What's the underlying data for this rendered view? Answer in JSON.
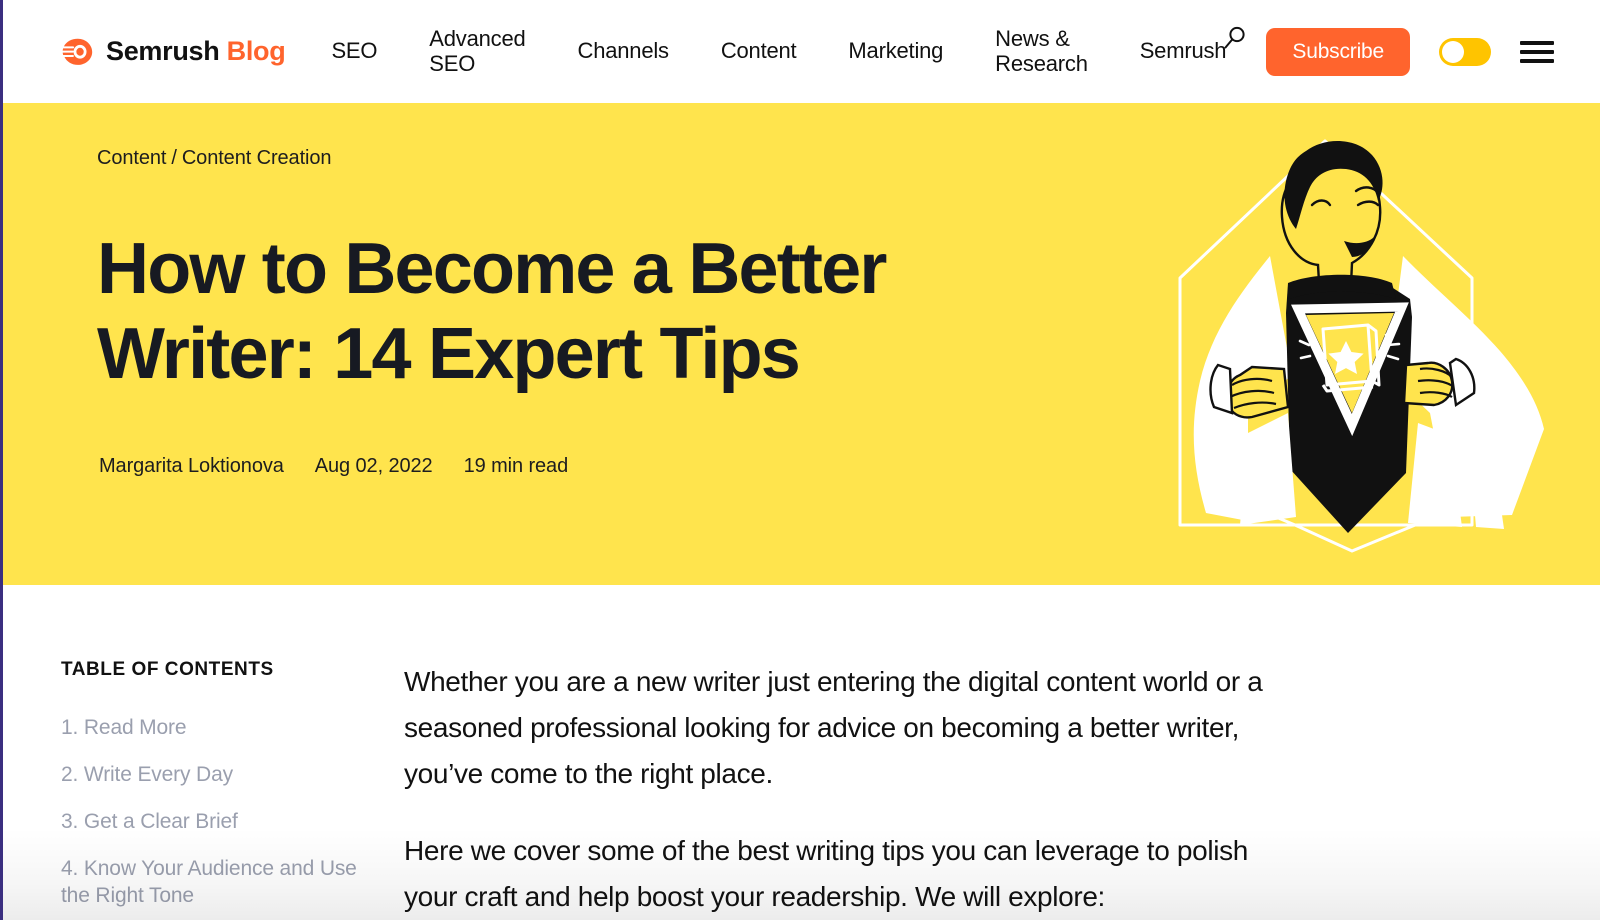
{
  "colors": {
    "brand_orange": "#ff642d",
    "hero_yellow": "#ffe44d",
    "toggle_yellow": "#ffc400",
    "text_dark": "#171a22",
    "toc_muted": "#9a9fae",
    "left_border": "#3b2f80"
  },
  "navbar": {
    "brand_name": "Semrush",
    "brand_suffix": "Blog",
    "links": [
      {
        "label": "SEO",
        "name": "nav-link-seo"
      },
      {
        "label": "Advanced\nSEO",
        "name": "nav-link-advanced-seo"
      },
      {
        "label": "Channels",
        "name": "nav-link-channels"
      },
      {
        "label": "Content",
        "name": "nav-link-content"
      },
      {
        "label": "Marketing",
        "name": "nav-link-marketing"
      },
      {
        "label": "News &\nResearch",
        "name": "nav-link-news-research"
      },
      {
        "label": "Semrush",
        "name": "nav-link-semrush"
      }
    ],
    "search_icon": "search-icon",
    "subscribe_label": "Subscribe",
    "theme_toggle_icon": "theme-toggle",
    "menu_icon": "hamburger-menu-icon"
  },
  "hero": {
    "breadcrumb": {
      "parent": "Content",
      "separator": "/",
      "current": "Content Creation"
    },
    "title": "How to Become a Better Writer: 14 Expert Tips",
    "meta": {
      "author": "Margarita Loktionova",
      "date": "Aug 02, 2022",
      "read_time": "19 min read"
    },
    "illustration": "superhero-opening-shirt-illustration"
  },
  "main": {
    "toc": {
      "heading": "TABLE OF CONTENTS",
      "items": [
        "1. Read More",
        "2. Write Every Day",
        "3. Get a Clear Brief",
        "4. Know Your Audience and Use the Right Tone"
      ]
    },
    "paragraphs": [
      "Whether you are a new writer just entering the digital content world or a seasoned professional looking for advice on becoming a better writer, you’ve come to the right place.",
      "Here we cover some of the best writing tips you can leverage to polish your craft and help boost your readership. We will explore:"
    ]
  }
}
